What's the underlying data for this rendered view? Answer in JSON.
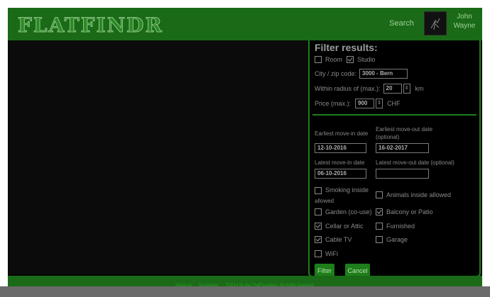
{
  "app": {
    "logo": "FLATFINDR"
  },
  "header": {
    "search_label": "Search",
    "user_first": "John",
    "user_last": "Wayne"
  },
  "filter": {
    "title": "Filter results:",
    "room_label": "Room",
    "studio_label": "Studio",
    "room_checked": false,
    "studio_checked": true,
    "city_label": "City / zip code:",
    "city_value": "3000 - Bern",
    "radius_label": "Within radius of (max.):",
    "radius_value": "20",
    "radius_unit": "km",
    "price_label": "Price (max.):",
    "price_value": "900",
    "price_unit": "CHF",
    "earliest_movein_label": "Earliest move-in date",
    "earliest_moveout_label": "Earliest move-out date (optional)",
    "earliest_movein_value": "12-10-2016",
    "earliest_moveout_value": "16-02-2017",
    "latest_movein_label": "Latest move-in date",
    "latest_moveout_label": "Latest move-out date (optional)",
    "latest_movein_value": "06-10-2016",
    "latest_moveout_value": "",
    "options": {
      "smoking_line1": "Smoking inside",
      "smoking_line2": "allowed",
      "animals": "Animals inside allowed",
      "garden": "Garden (co-use)",
      "balcony": "Balcony or Patio",
      "cellar": "Cellar or Attic",
      "furnished": "Furnished",
      "cable": "Cable TV",
      "garage": "Garage",
      "wifi": "WiFi"
    },
    "filter_button": "Filter",
    "cancel_button": "Cancel"
  },
  "footer": {
    "about": "About us",
    "disclaimer": "Disclaimer",
    "copyright": "©2014 by the FlatFounders. All rights reserved."
  },
  "colors": {
    "brand_green": "#1a6a17",
    "accent_green": "#1e7e1a"
  }
}
